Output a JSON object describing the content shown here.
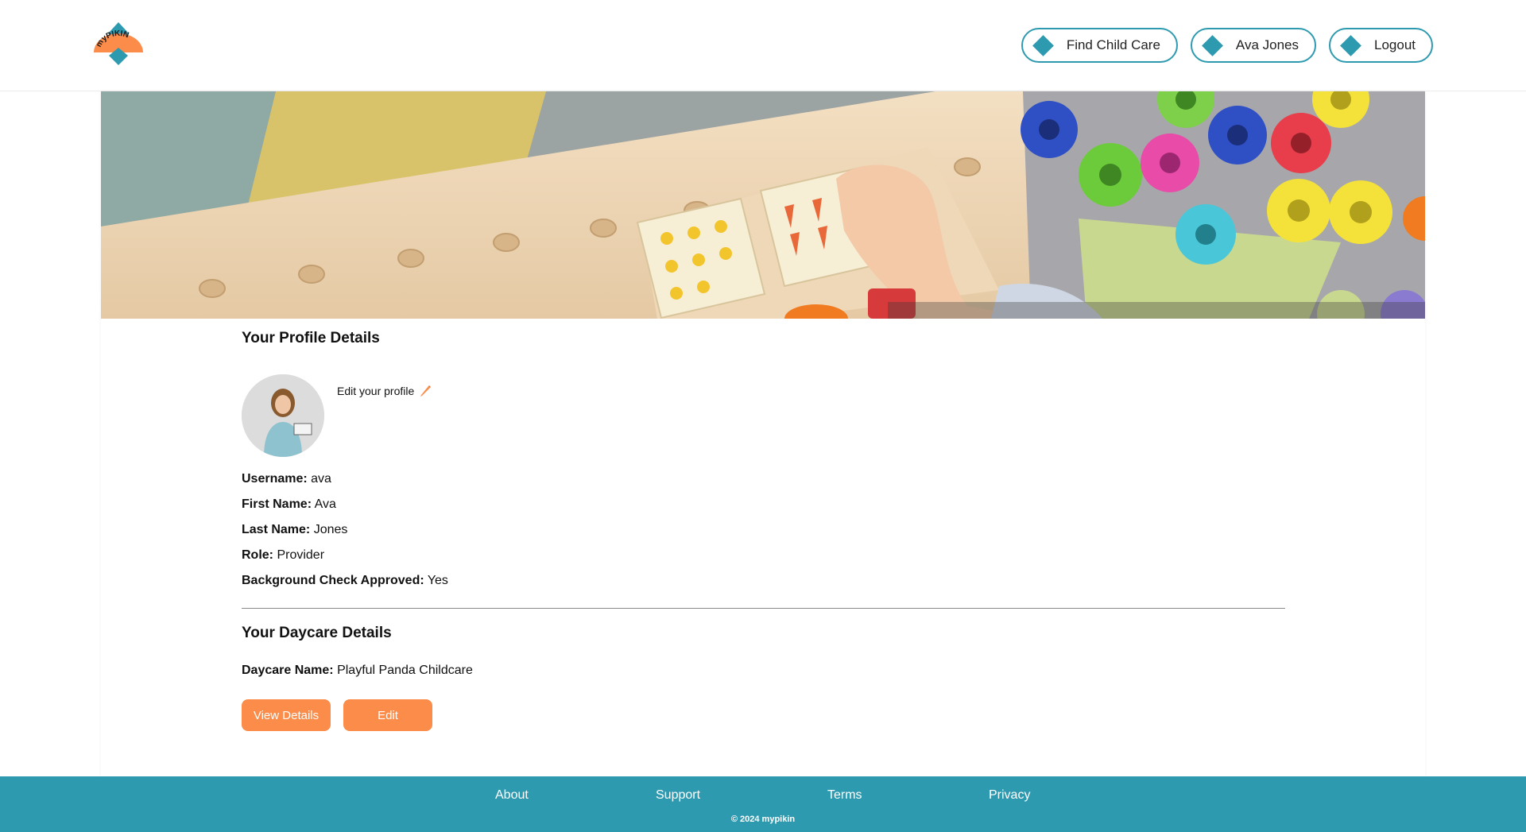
{
  "brand": {
    "logo_text": "myPIKIN",
    "primary_color": "#2e9ab0",
    "accent_color": "#fb8c49"
  },
  "nav": {
    "items": [
      {
        "label": "Find Child Care",
        "icon": "diamond-icon"
      },
      {
        "label": "Ava Jones",
        "icon": "diamond-icon"
      },
      {
        "label": "Logout",
        "icon": "diamond-icon"
      }
    ]
  },
  "profile": {
    "title": "Your Profile Details",
    "edit_label": "Edit your profile",
    "edit_icon": "pencil-icon",
    "fields": [
      {
        "label": "Username:",
        "value": "ava"
      },
      {
        "label": "First Name:",
        "value": "Ava"
      },
      {
        "label": "Last Name:",
        "value": "Jones"
      },
      {
        "label": "Role:",
        "value": "Provider"
      },
      {
        "label": "Background Check Approved:",
        "value": "Yes"
      }
    ]
  },
  "daycare": {
    "title": "Your Daycare Details",
    "name_label": "Daycare Name:",
    "name_value": "Playful Panda Childcare",
    "view_label": "View Details",
    "edit_label": "Edit"
  },
  "footer": {
    "links": [
      "About",
      "Support",
      "Terms",
      "Privacy"
    ],
    "copyright": "© 2024 mypikin"
  }
}
